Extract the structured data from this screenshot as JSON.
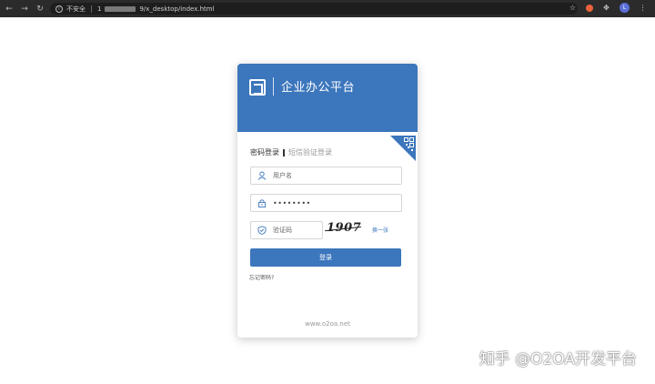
{
  "browser": {
    "security_label": "不安全",
    "url_prefix": "1",
    "url_suffix": "9/x_desktop/index.html",
    "avatar_letter": "L"
  },
  "header": {
    "title": "企业办公平台"
  },
  "tabs": {
    "password_login": "密码登录",
    "sms_login": "短信验证登录"
  },
  "form": {
    "username_placeholder": "用户名",
    "password_value": "••••••••",
    "captcha_placeholder": "验证码",
    "captcha_text": "1907",
    "refresh_label": "换一张",
    "login_button": "登录",
    "forgot_password": "忘记密码?"
  },
  "footer": {
    "url": "www.o2oa.net"
  },
  "watermark": {
    "text": "知乎 @O2OA开发平台"
  },
  "colors": {
    "accent": "#3c76bc",
    "chrome_bg": "#2b2b2b"
  }
}
